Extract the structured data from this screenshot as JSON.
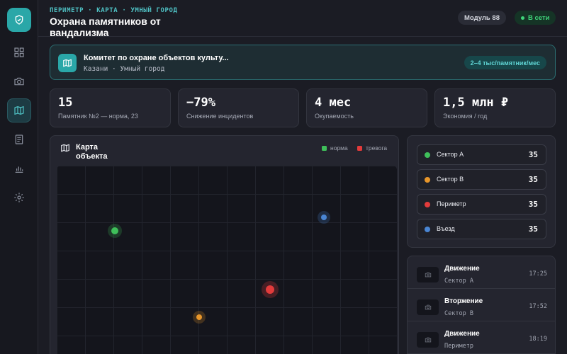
{
  "sidebar": {
    "logo_icon": "shield-check-icon",
    "items": [
      {
        "icon": "dashboard-icon",
        "active": false
      },
      {
        "icon": "camera-icon",
        "active": false
      },
      {
        "icon": "map-icon",
        "active": true
      },
      {
        "icon": "document-icon",
        "active": false
      },
      {
        "icon": "chart-icon",
        "active": false
      },
      {
        "icon": "gear-icon",
        "active": false
      }
    ]
  },
  "header": {
    "breadcrumb": "ПЕРИМЕТР · КАРТА · УМНЫЙ ГОРОД",
    "title": "Охрана памятников от вандализма",
    "module_label": "Модуль 88",
    "status_label": "В сети"
  },
  "banner": {
    "title": "Комитет по охране объектов культу...",
    "subtitle": "Казани · Умный город",
    "badge": "2–4 тыс/памятник/мес"
  },
  "stats": [
    {
      "value": "15",
      "label": "Памятник №2 — норма, 23"
    },
    {
      "value": "−79%",
      "label": "Снижение инцидентов"
    },
    {
      "value": "4 мес",
      "label": "Окупаемость"
    },
    {
      "value": "1,5 млн ₽",
      "label": "Экономия / год"
    }
  ],
  "map": {
    "title": "Карта объекта",
    "legend": [
      {
        "label": "норма",
        "color": "#3fbf5a"
      },
      {
        "label": "тревога",
        "color": "#e23b3b"
      }
    ],
    "markers": [
      {
        "name": "marker-sector-a",
        "color": "#3fbf5a"
      },
      {
        "name": "marker-entrance",
        "color": "#4a86d4"
      },
      {
        "name": "marker-perimeter",
        "color": "#e23b3b"
      },
      {
        "name": "marker-sector-b",
        "color": "#e8962a"
      }
    ]
  },
  "sectors": [
    {
      "name": "Сектор А",
      "count": "35",
      "color": "#3fbf5a"
    },
    {
      "name": "Сектор В",
      "count": "35",
      "color": "#e8962a"
    },
    {
      "name": "Периметр",
      "count": "35",
      "color": "#e23b3b"
    },
    {
      "name": "Въезд",
      "count": "35",
      "color": "#4a86d4"
    }
  ],
  "events": [
    {
      "title": "Движение",
      "sector": "Сектор А",
      "time": "17:25"
    },
    {
      "title": "Вторжение",
      "sector": "Сектор В",
      "time": "17:52"
    },
    {
      "title": "Движение",
      "sector": "Периметр",
      "time": "18:19"
    }
  ]
}
